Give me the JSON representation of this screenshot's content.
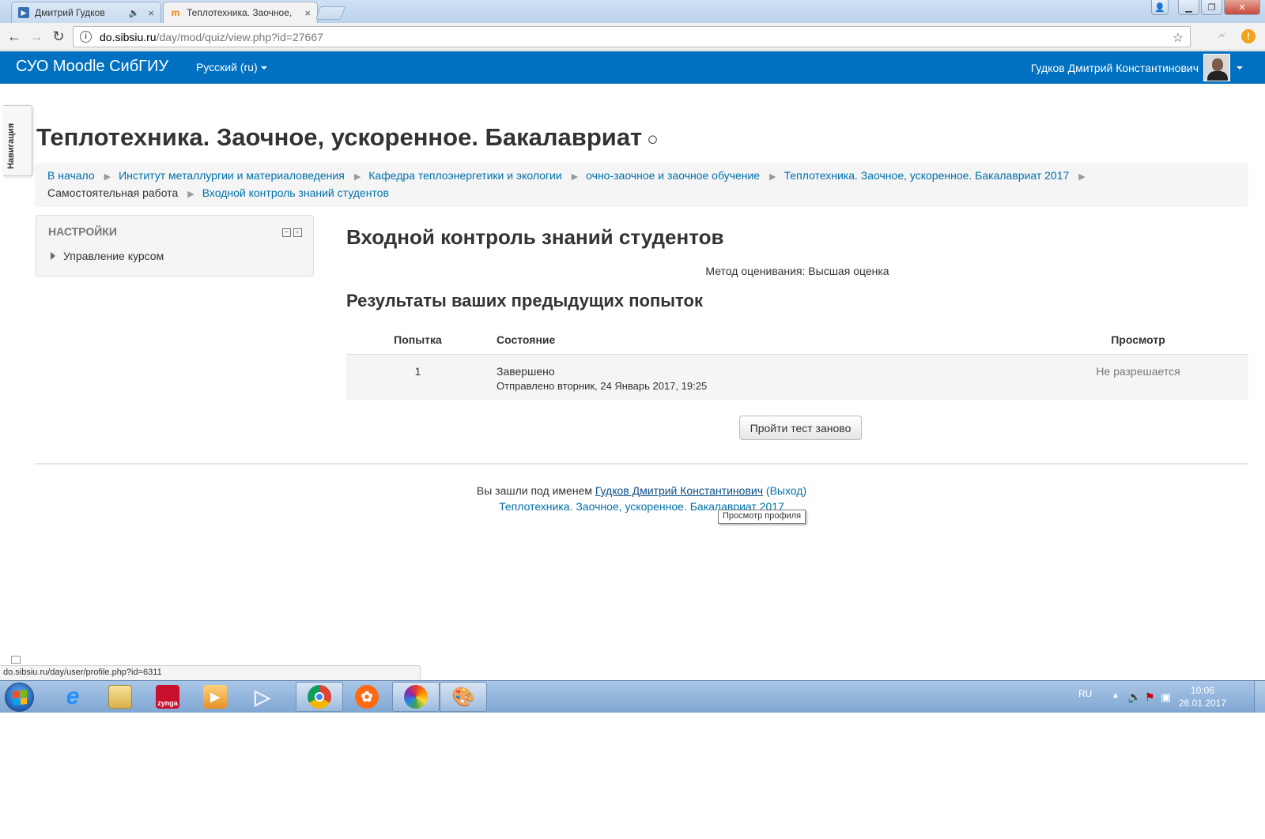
{
  "browser": {
    "tabs": [
      {
        "title": "Дмитрий Гудков",
        "active": false
      },
      {
        "title": "Теплотехника. Заочное,",
        "active": true
      }
    ],
    "url_host": "do.sibsiu.ru",
    "url_path": "/day/mod/quiz/view.php?id=27667",
    "status_url": "do.sibsiu.ru/day/user/profile.php?id=6311"
  },
  "navbar": {
    "brand": "СУО Moodle СибГИУ",
    "language": "Русский (ru)",
    "user": "Гудков Дмитрий Константинович"
  },
  "dock": {
    "label": "Навигация"
  },
  "page": {
    "title": "Теплотехника. Заочное, ускоренное. Бакалавриат",
    "title_suffix": "○"
  },
  "breadcrumb": [
    {
      "label": "В начало",
      "link": true
    },
    {
      "label": "Институт металлургии и материаловедения",
      "link": true
    },
    {
      "label": "Кафедра теплоэнергетики и экологии",
      "link": true
    },
    {
      "label": "очно-заочное и заочное обучение",
      "link": true
    },
    {
      "label": "Теплотехника. Заочное, ускоренное. Бакалавриат 2017",
      "link": true
    },
    {
      "label": "Самостоятельная работа",
      "link": false
    },
    {
      "label": "Входной контроль знаний студентов",
      "link": true
    }
  ],
  "settings": {
    "header": "НАСТРОЙКИ",
    "item": "Управление курсом"
  },
  "quiz": {
    "title": "Входной контроль знаний студентов",
    "grading_method": "Метод оценивания: Высшая оценка",
    "results_heading": "Результаты ваших предыдущих попыток",
    "columns": [
      "Попытка",
      "Состояние",
      "Просмотр"
    ],
    "rows": [
      {
        "attempt": "1",
        "state": "Завершено",
        "submitted": "Отправлено вторник, 24 Январь 2017, 19:25",
        "review": "Не разрешается"
      }
    ],
    "retry_button": "Пройти тест заново"
  },
  "footer": {
    "logged_in_prefix": "Вы зашли под именем ",
    "user": "Гудков Дмитрий Константинович",
    "logout": "(Выход)",
    "course": "Теплотехника. Заочное, ускоренное. Бакалавриат 2017",
    "tooltip": "Просмотр профиля"
  },
  "taskbar": {
    "apps": [
      "internet-explorer",
      "file-explorer",
      "zynga",
      "media-player",
      "video-player",
      "chrome",
      "app-orange",
      "app-colorful",
      "paint"
    ],
    "tray_lang": "RU",
    "time": "10:06",
    "date": "26.01.2017"
  }
}
